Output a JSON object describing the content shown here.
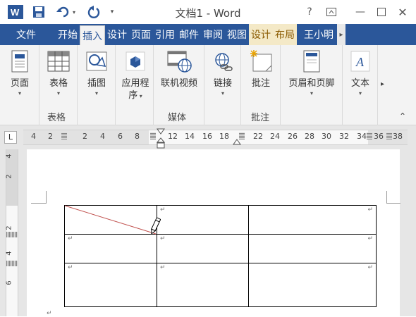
{
  "window": {
    "title": "文档1 - Word",
    "help": "?",
    "user": "王小明"
  },
  "tabs": [
    {
      "label": "文件"
    },
    {
      "label": "开始"
    },
    {
      "label": "插入"
    },
    {
      "label": "设计"
    },
    {
      "label": "页面"
    },
    {
      "label": "引用"
    },
    {
      "label": "邮件"
    },
    {
      "label": "审阅"
    },
    {
      "label": "视图"
    },
    {
      "label": "设计"
    },
    {
      "label": "布局"
    }
  ],
  "ribbon": {
    "page": {
      "label": "页面"
    },
    "table": {
      "label": "表格",
      "group": "表格"
    },
    "illustrations": {
      "label": "插图"
    },
    "apps": {
      "label1": "应用程",
      "label2": "序"
    },
    "video": {
      "label": "联机视频",
      "group": "媒体"
    },
    "link": {
      "label": "链接"
    },
    "comment": {
      "label": "批注",
      "group": "批注"
    },
    "header": {
      "label": "页眉和页脚"
    },
    "text": {
      "label": "文本"
    }
  },
  "hruler": [
    "4",
    "2",
    "2",
    "4",
    "6",
    "8",
    "12",
    "14",
    "16",
    "18",
    "22",
    "24",
    "26",
    "28",
    "30",
    "32",
    "34",
    "36",
    "38"
  ],
  "vruler": [
    "4",
    "2",
    "2",
    "4",
    "6"
  ],
  "table": {
    "rows": 3,
    "cols": 3,
    "cell_mark": "↵"
  },
  "colors": {
    "accent": "#2b579a",
    "diagonal": "#c0504d"
  }
}
